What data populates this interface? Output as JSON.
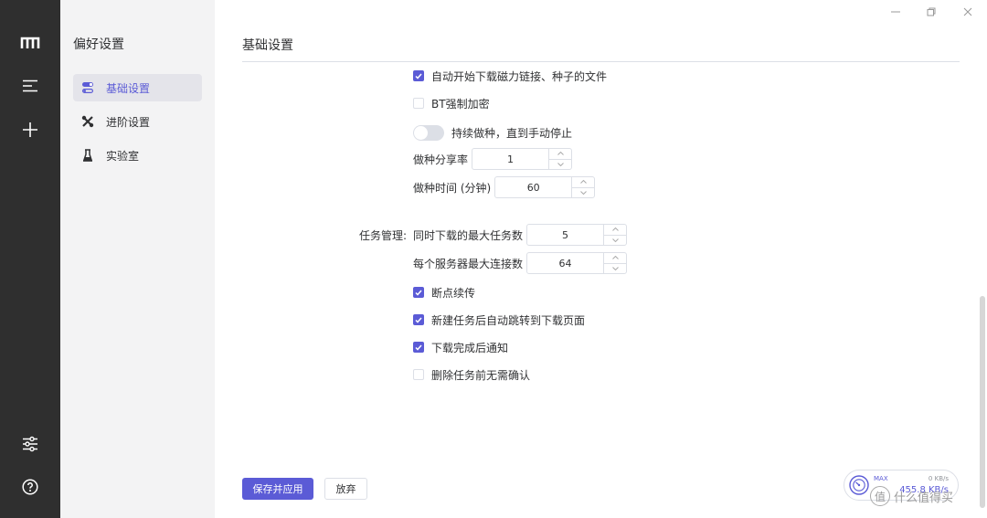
{
  "sidebar": {
    "title": "偏好设置",
    "items": [
      {
        "label": "基础设置",
        "icon": "toggle-icon",
        "active": true
      },
      {
        "label": "进阶设置",
        "icon": "tools-icon",
        "active": false
      },
      {
        "label": "实验室",
        "icon": "lab-icon",
        "active": false
      }
    ]
  },
  "rail": {
    "icons": [
      "logo-icon",
      "menu-icon",
      "add-icon",
      "preferences-icon",
      "help-icon"
    ]
  },
  "main": {
    "title": "基础设置",
    "options": {
      "auto_magnet": {
        "label": "自动开始下载磁力链接、种子的文件",
        "checked": true
      },
      "bt_encrypt": {
        "label": "BT强制加密",
        "checked": false
      },
      "keep_seeding": {
        "label": "持续做种，直到手动停止",
        "on": false
      },
      "seed_ratio": {
        "label": "做种分享率",
        "value": "1"
      },
      "seed_time": {
        "label": "做种时间 (分钟)",
        "value": "60"
      }
    },
    "task": {
      "group_label": "任务管理:",
      "max_tasks": {
        "label": "同时下载的最大任务数",
        "value": "5"
      },
      "max_conn": {
        "label": "每个服务器最大连接数",
        "value": "64"
      },
      "resume": {
        "label": "断点续传",
        "checked": true
      },
      "jump_to_downloads": {
        "label": "新建任务后自动跳转到下载页面",
        "checked": true
      },
      "notify_done": {
        "label": "下载完成后通知",
        "checked": true
      },
      "no_confirm_delete": {
        "label": "删除任务前无需确认",
        "checked": false
      }
    },
    "buttons": {
      "save": "保存并应用",
      "discard": "放弃"
    }
  },
  "speed": {
    "max_label": "MAX",
    "upload": "0 KB/s",
    "download": "455.8 KB/s"
  },
  "watermark": {
    "text": "什么值得买",
    "icon_glyph": "值"
  },
  "colors": {
    "accent": "#5b5bd6",
    "rail": "#2f2f2f",
    "sidebar": "#f3f3f4"
  }
}
